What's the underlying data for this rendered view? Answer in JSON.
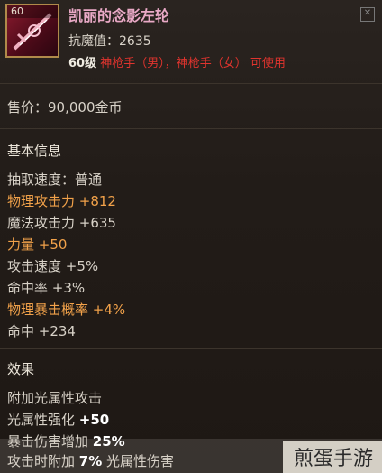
{
  "item": {
    "level_badge": "60",
    "name": "凯丽的念影左轮",
    "resist_label": "抗魔值：2635",
    "level_req": "60级",
    "class_req": "神枪手（男），神枪手（女） 可使用"
  },
  "price": "售价：90,000金币",
  "basic_info": {
    "title": "基本信息",
    "stats": [
      {
        "label": "抽取速度：普通",
        "value": ""
      },
      {
        "label": "物理攻击力 ",
        "value": "+812"
      },
      {
        "label": "魔法攻击力 ",
        "value": "+635"
      },
      {
        "label": "力量 ",
        "value": "+50"
      },
      {
        "label": "攻击速度 ",
        "value": "+5%"
      },
      {
        "label": "命中率 ",
        "value": "+3%"
      },
      {
        "label": "物理暴击概率 ",
        "value": "+4%"
      },
      {
        "label": "命中 ",
        "value": "+234"
      }
    ]
  },
  "effects": {
    "title": "效果",
    "lines": [
      {
        "label": "附加光属性攻击",
        "value": ""
      },
      {
        "label": "光属性强化 ",
        "value": "+50"
      },
      {
        "label": "暴击伤害增加 ",
        "value": "25%"
      },
      {
        "label": "攻击时附加 ",
        "value": "7%",
        "suffix": " 光属性伤害"
      }
    ]
  },
  "watermark": "煎蛋手游",
  "colors": {
    "highlight": "#f2a24a",
    "class_req": "#e0342e",
    "title": "#e9a9c6"
  }
}
